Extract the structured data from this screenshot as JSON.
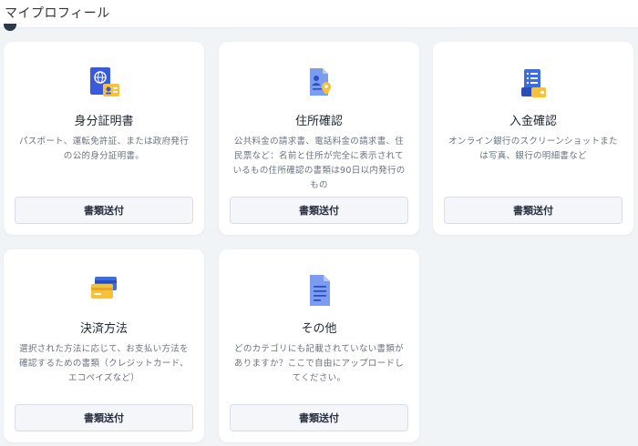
{
  "page": {
    "title": "マイプロフィール"
  },
  "cards": [
    {
      "icon": "passport-id-icon",
      "title": "身分証明書",
      "description": "パスポート、運転免許証、または政府発行の公的身分証明書。",
      "button": "書類送付"
    },
    {
      "icon": "address-document-icon",
      "title": "住所確認",
      "description": "公共料金の請求書、電話料金の請求書、住民票など：名前と住所が完全に表示されているもの住所確認の書類は90日以内発行のもの",
      "button": "書類送付"
    },
    {
      "icon": "bank-deposit-icon",
      "title": "入金確認",
      "description": "オンライン銀行のスクリーンショットまたは写真、銀行の明細書など",
      "button": "書類送付"
    },
    {
      "icon": "credit-card-icon",
      "title": "決済方法",
      "description": "選択された方法に応じて、お支払い方法を確認するための書類（クレジットカード、エコペイズなど）",
      "button": "書類送付"
    },
    {
      "icon": "document-icon",
      "title": "その他",
      "description": "どのカテゴリにも記載されていない書類がありますか？ここで自由にアップロードしてください。",
      "button": "書類送付"
    }
  ],
  "colors": {
    "background": "#f1f4f7",
    "card": "#ffffff",
    "icon_blue": "#3d6ee0",
    "icon_yellow": "#f5c23a"
  }
}
